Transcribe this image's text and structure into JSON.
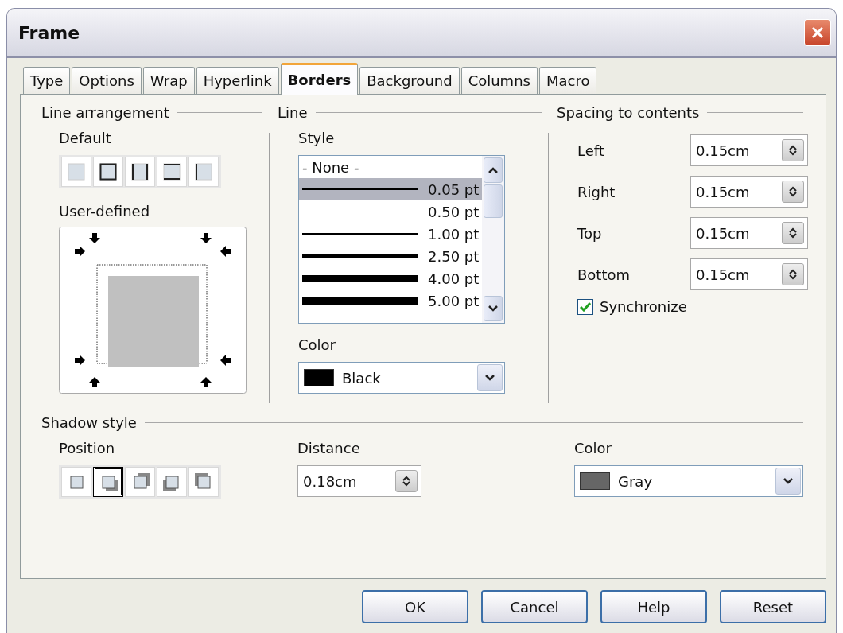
{
  "window": {
    "title": "Frame"
  },
  "tabs": [
    {
      "label": "Type",
      "selected": false
    },
    {
      "label": "Options",
      "selected": false
    },
    {
      "label": "Wrap",
      "selected": false
    },
    {
      "label": "Hyperlink",
      "selected": false
    },
    {
      "label": "Borders",
      "selected": true
    },
    {
      "label": "Background",
      "selected": false
    },
    {
      "label": "Columns",
      "selected": false
    },
    {
      "label": "Macro",
      "selected": false
    }
  ],
  "line_arrangement": {
    "title": "Line arrangement",
    "default_label": "Default",
    "presets": [
      {
        "kind": "none"
      },
      {
        "kind": "box"
      },
      {
        "kind": "sides"
      },
      {
        "kind": "topbottom"
      },
      {
        "kind": "left"
      }
    ],
    "user_defined_label": "User-defined"
  },
  "line": {
    "title": "Line",
    "style_label": "Style",
    "styles": [
      {
        "kind": "none",
        "label": "- None -",
        "selected": false
      },
      {
        "kind": "line",
        "label": "0.05 pt",
        "selected": true
      },
      {
        "kind": "line",
        "label": "0.50 pt",
        "selected": false
      },
      {
        "kind": "line",
        "label": "1.00 pt",
        "selected": false
      },
      {
        "kind": "line",
        "label": "2.50 pt",
        "selected": false
      },
      {
        "kind": "line",
        "label": "4.00 pt",
        "selected": false
      },
      {
        "kind": "line",
        "label": "5.00 pt",
        "selected": false
      }
    ],
    "color_label": "Color",
    "color": {
      "label": "Black",
      "color": "#000000"
    }
  },
  "spacing": {
    "title": "Spacing to contents",
    "fields": [
      {
        "label": "Left",
        "value": "0.15cm"
      },
      {
        "label": "Right",
        "value": "0.15cm"
      },
      {
        "label": "Top",
        "value": "0.15cm"
      },
      {
        "label": "Bottom",
        "value": "0.15cm"
      }
    ],
    "synchronize": {
      "label": "Synchronize",
      "checked": true
    }
  },
  "shadow": {
    "title": "Shadow style",
    "position_label": "Position",
    "positions": [
      {
        "kind": "none",
        "selected": false
      },
      {
        "kind": "bottom-right",
        "selected": true
      },
      {
        "kind": "top-right",
        "selected": false
      },
      {
        "kind": "bottom-left",
        "selected": false
      },
      {
        "kind": "top-left",
        "selected": false
      }
    ],
    "distance_label": "Distance",
    "distance": "0.18cm",
    "color_label": "Color",
    "color": {
      "label": "Gray",
      "color": "#666666"
    }
  },
  "buttons": [
    "OK",
    "Cancel",
    "Help",
    "Reset"
  ]
}
